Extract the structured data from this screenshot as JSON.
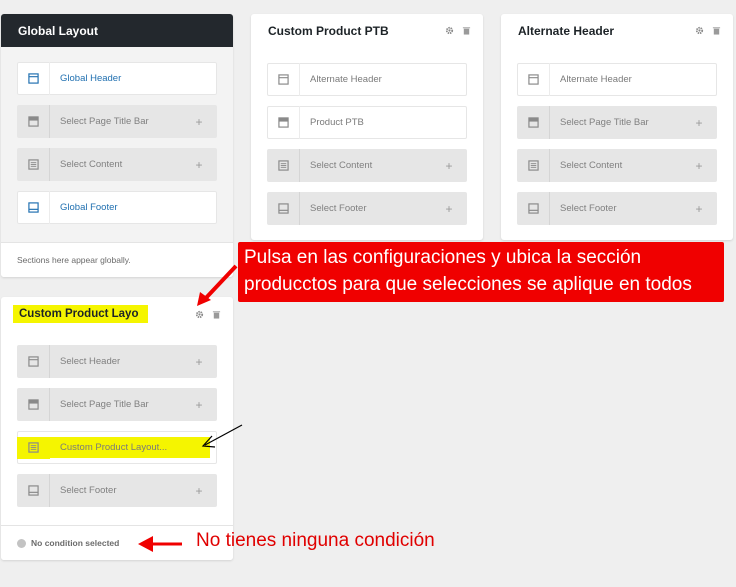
{
  "colors": {
    "accent_blue": "#2271b1",
    "callout_red": "#f00000",
    "highlight_yellow": "#f5f500",
    "dark_header": "#23282d"
  },
  "global_layout": {
    "title": "Global Layout",
    "rows": [
      {
        "label": "Global Header",
        "state": "filled",
        "icon": "header-icon"
      },
      {
        "label": "Select Page Title Bar",
        "state": "empty",
        "icon": "title-bar-icon"
      },
      {
        "label": "Select Content",
        "state": "empty",
        "icon": "content-icon"
      },
      {
        "label": "Global Footer",
        "state": "filled",
        "icon": "footer-icon"
      }
    ],
    "footer_text": "Sections here appear globally."
  },
  "custom_ptb": {
    "title": "Custom Product PTB",
    "rows": [
      {
        "label": "Alternate Header",
        "state": "filled",
        "icon": "header-icon"
      },
      {
        "label": "Product PTB",
        "state": "filled",
        "icon": "title-bar-icon"
      },
      {
        "label": "Select Content",
        "state": "empty",
        "icon": "content-icon"
      },
      {
        "label": "Select Footer",
        "state": "empty",
        "icon": "footer-icon"
      }
    ]
  },
  "alternate_header": {
    "title": "Alternate Header",
    "rows": [
      {
        "label": "Alternate Header",
        "state": "filled",
        "icon": "header-icon"
      },
      {
        "label": "Select Page Title Bar",
        "state": "empty",
        "icon": "title-bar-icon"
      },
      {
        "label": "Select Content",
        "state": "empty",
        "icon": "content-icon"
      },
      {
        "label": "Select Footer",
        "state": "empty",
        "icon": "footer-icon"
      }
    ]
  },
  "custom_product_layout": {
    "title": "Custom Product Layo",
    "rows": [
      {
        "label": "Select Header",
        "state": "empty",
        "icon": "header-icon"
      },
      {
        "label": "Select Page Title Bar",
        "state": "empty",
        "icon": "title-bar-icon"
      },
      {
        "label": "Custom Product Layout...",
        "state": "filled",
        "icon": "content-icon"
      },
      {
        "label": "Select Footer",
        "state": "empty",
        "icon": "footer-icon"
      }
    ],
    "footer_text": "No condition selected"
  },
  "plus_symbol": "+",
  "annotations": {
    "settings_callout": "Pulsa en las configuraciones y ubica la sección producctos para que selecciones se aplique en todos",
    "no_condition_note": "No tienes ninguna condición"
  }
}
